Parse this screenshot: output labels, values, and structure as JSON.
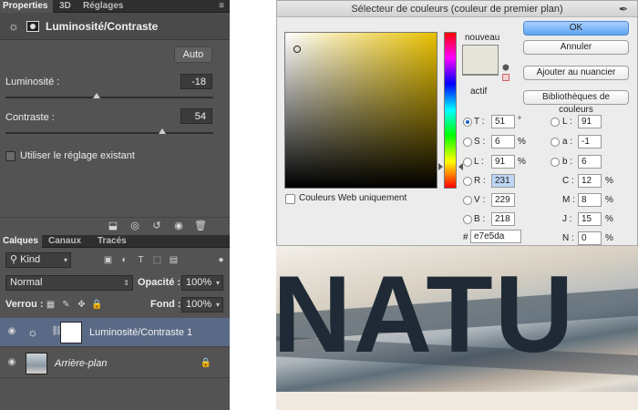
{
  "properties_panel": {
    "tabs": [
      "Properties",
      "3D",
      "Réglages"
    ],
    "title": "Luminosité/Contraste",
    "auto_label": "Auto",
    "brightness": {
      "label": "Luminosité :",
      "value": "-18"
    },
    "contrast": {
      "label": "Contraste :",
      "value": "54"
    },
    "use_legacy_label": "Utiliser le réglage existant",
    "menu_glyph": "≡"
  },
  "layers_panel": {
    "tabs": [
      "Calques",
      "Canaux",
      "Tracés"
    ],
    "filter_kind": "Kind",
    "blend_mode": "Normal",
    "opacity_label": "Opacité :",
    "opacity_value": "100%",
    "lock_label": "Verrou :",
    "fill_label": "Fond :",
    "fill_value": "100%",
    "layers": [
      {
        "name": "Luminosité/Contraste 1",
        "selected": true,
        "icon": "sun-adjustment-icon"
      },
      {
        "name": "Arrière-plan",
        "selected": false,
        "icon": "lock-icon"
      }
    ]
  },
  "color_picker": {
    "title": "Sélecteur de couleurs (couleur de premier plan)",
    "new_label": "nouveau",
    "current_label": "actif",
    "new_color": "#e7e5da",
    "current_color": "#e7e5da",
    "web_only_label": "Couleurs Web uniquement",
    "buttons": {
      "ok": "OK",
      "cancel": "Annuler",
      "add_swatch": "Ajouter au nuancier",
      "libraries": "Bibliothèques de couleurs"
    },
    "hsb": {
      "h": {
        "label": "T :",
        "value": "51",
        "unit": "°"
      },
      "s": {
        "label": "S :",
        "value": "6",
        "unit": "%"
      },
      "b": {
        "label": "L :",
        "value": "91",
        "unit": "%"
      }
    },
    "rgb": {
      "r": {
        "label": "R :",
        "value": "231"
      },
      "g": {
        "label": "V :",
        "value": "229"
      },
      "b": {
        "label": "B :",
        "value": "218"
      }
    },
    "lab": {
      "l": {
        "label": "L :",
        "value": "91"
      },
      "a": {
        "label": "a :",
        "value": "-1"
      },
      "b": {
        "label": "b :",
        "value": "6"
      }
    },
    "cmyk": {
      "c": {
        "label": "C :",
        "value": "12",
        "unit": "%"
      },
      "m": {
        "label": "M :",
        "value": "8",
        "unit": "%"
      },
      "y": {
        "label": "J :",
        "value": "15",
        "unit": "%"
      },
      "k": {
        "label": "N :",
        "value": "0",
        "unit": "%"
      }
    },
    "hex_label": "#",
    "hex_value": "e7e5da"
  },
  "canvas": {
    "text": "NATU"
  }
}
